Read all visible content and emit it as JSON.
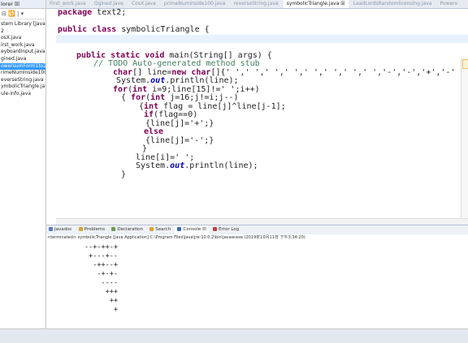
{
  "explorer": {
    "title": "lorer ☒",
    "tools_row": "⊟ 🔁 | ▾",
    "items": [
      {
        "label": "stem Library [JavaSE",
        "selected": false
      },
      {
        "label": "2",
        "selected": false
      },
      {
        "label": "osX.java",
        "selected": false
      },
      {
        "label": "irst_work.java",
        "selected": false
      },
      {
        "label": "eyboardInput.java",
        "selected": false
      },
      {
        "label": "gined.java",
        "selected": false
      },
      {
        "label": "owersumForm1to20",
        "selected": true
      },
      {
        "label": "rimeNumInside100(",
        "selected": false
      },
      {
        "label": "everseString.java",
        "selected": false
      },
      {
        "label": "ymbolicTriangle.java",
        "selected": false
      },
      {
        "label": "ule-info.java",
        "selected": false
      }
    ]
  },
  "tabs": [
    {
      "label": "First_work.java",
      "active": false
    },
    {
      "label": "Ogined.java",
      "active": false
    },
    {
      "label": "CosX.java",
      "active": false
    },
    {
      "label": "primeNumInside100.java",
      "active": false
    },
    {
      "label": "reverseString.java",
      "active": false
    },
    {
      "label": "symbolicTriangle.java ☒",
      "active": true
    },
    {
      "label": "LeadLordsRandomlicensing.java",
      "active": false
    },
    {
      "label": "Powers",
      "active": false
    }
  ],
  "code": {
    "line_package": "package text2;",
    "line_class_kw": "public class",
    "line_class_name": " symbolicTriangle {",
    "main_kw": "public static void",
    "main_rest": " main(String[] args) {",
    "todo": "// TODO Auto-generated method stub",
    "char_kw": "char",
    "char_mid": "[] line=",
    "char_new": "new char",
    "char_rest": "[]{' ',' ',' ',' ',' ',' ',' ',' ','-','-','+','-'",
    "sys1_a": "System.",
    "sys1_out": "out",
    "sys1_b": ".println(line);",
    "for1_kw": "for",
    "for1_a": "(",
    "for1_int": "int",
    "for1_b": " i=9;line[15]!=' ';i++)",
    "brace_open1": "{ ",
    "for2_kw": "for",
    "for2_a": "(",
    "for2_int": "int",
    "for2_b": " j=16;j!=i;j--)",
    "brace_int": "{",
    "int_kw": "int",
    "flag_rest": " flag = line[j]^line[j-1];",
    "if_kw": "if",
    "if_rest": "(flag==0)",
    "plus_line": "{line[j]='+';}",
    "else_kw": "else",
    "minus_line": "{line[j]='-';}",
    "close_brace": "}",
    "line_space": "line[i]=' ';",
    "sys2_a": "System.",
    "sys2_out": "out",
    "sys2_b": ".println(line);",
    "close_brace2": "}"
  },
  "console": {
    "tabs": [
      {
        "label": "Javadoc",
        "active": false,
        "color": "#5b7fbf"
      },
      {
        "label": "Problems",
        "active": false,
        "color": "#d9a13a"
      },
      {
        "label": "Declaration",
        "active": false,
        "color": "#6a9a5a"
      },
      {
        "label": "Search",
        "active": false,
        "color": "#e0a030"
      },
      {
        "label": "Console ☒",
        "active": true,
        "color": "#3a6fb0"
      },
      {
        "label": "Error Log",
        "active": false,
        "color": "#c04040"
      }
    ],
    "header": "<terminated> symbolicTriangle [Java Application] C:\\Program Files\\Java\\jre-10.0.2\\bin\\javaw.exe (2019年10月11日 下午3:34:20)",
    "output": [
      "--+-++-+",
      " +---+--",
      "  -++--+",
      "   -+-+-",
      "    ----",
      "     +++",
      "      ++",
      "       +"
    ]
  },
  "colors": {
    "keyword": "#7f0055",
    "comment": "#3f7f5f",
    "string": "#2a00ff",
    "field": "#0000c0",
    "selection": "#3399ff"
  }
}
